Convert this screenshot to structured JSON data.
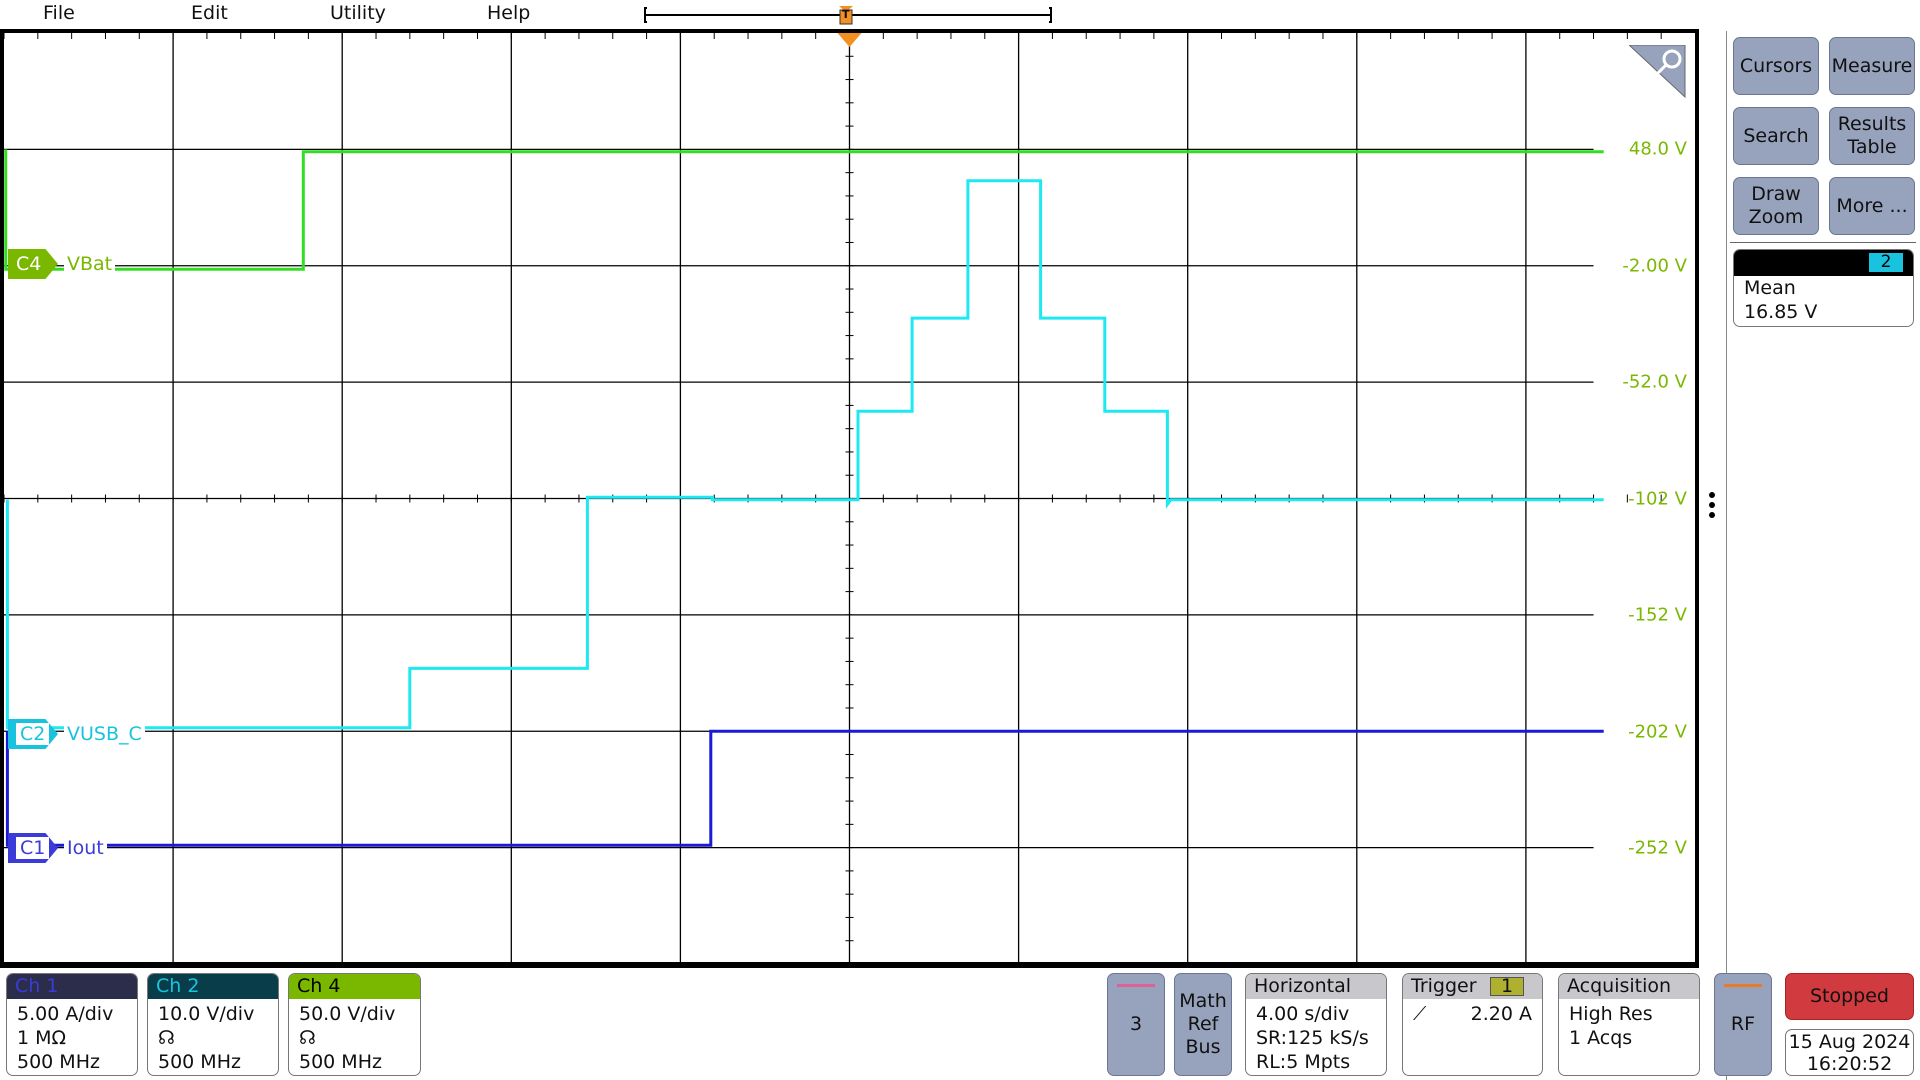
{
  "menu": {
    "file": "File",
    "edit": "Edit",
    "utility": "Utility",
    "help": "Help"
  },
  "timeline": {
    "trigger_marker": "T"
  },
  "scale_labels": [
    "48.0 V",
    "-2.00 V",
    "-52.0 V",
    "-102 V",
    "-152 V",
    "-202 V",
    "-252 V"
  ],
  "channels": {
    "c4": {
      "tag": "C4",
      "name": "VBat",
      "color": "#7ab800",
      "trace": "#33dd22"
    },
    "c2": {
      "tag": "C2",
      "name": "VUSB_C",
      "color": "#19c3e0",
      "trace": "#1ee8f2"
    },
    "c1": {
      "tag": "C1",
      "name": "Iout",
      "color": "#3b3bd9",
      "trace": "#1a1ad8"
    }
  },
  "side": {
    "cursors": "Cursors",
    "measure": "Measure",
    "search": "Search",
    "results_line1": "Results",
    "results_line2": "Table",
    "draw_line1": "Draw",
    "draw_line2": "Zoom",
    "more": "More ...",
    "measurement": {
      "badge": "2",
      "name": "Mean",
      "value": "16.85 V"
    }
  },
  "bottom": {
    "ch1": {
      "title": "Ch 1",
      "scale": "5.00 A/div",
      "impedance": "1 MΩ",
      "bandwidth": "500 MHz"
    },
    "ch2": {
      "title": "Ch 2",
      "scale": "10.0 V/div",
      "bandwidth": "500 MHz"
    },
    "ch4": {
      "title": "Ch 4",
      "scale": "50.0 V/div",
      "bandwidth": "500 MHz"
    },
    "ch3_button": "3",
    "math_ref_bus": [
      "Math",
      "Ref",
      "Bus"
    ],
    "horizontal": {
      "title": "Horizontal",
      "scale": "4.00 s/div",
      "sample_rate": "SR:125 kS/s",
      "record_length": "RL:5 Mpts"
    },
    "trigger": {
      "title": "Trigger",
      "source": "1",
      "level": "2.20 A",
      "slope": "rising"
    },
    "acquisition": {
      "title": "Acquisition",
      "mode": "High Res",
      "count": "1 Acqs"
    },
    "rf": "RF",
    "status": "Stopped",
    "date": "15 Aug 2024",
    "time": "16:20:52"
  }
}
